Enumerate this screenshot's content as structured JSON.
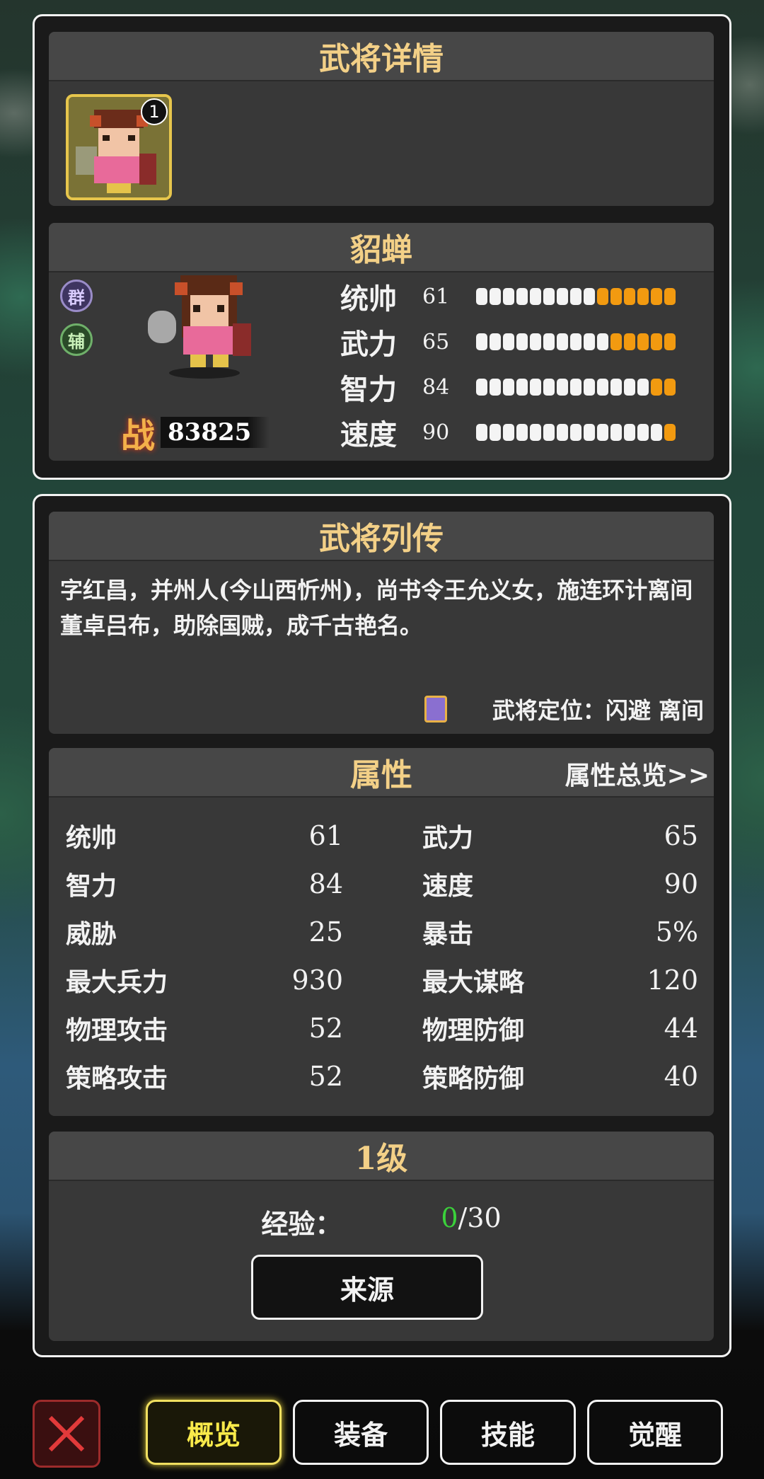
{
  "details": {
    "title": "武将详情",
    "portrait_level": "1"
  },
  "hero": {
    "name": "貂蝉",
    "faction_tags": [
      "群",
      "辅"
    ],
    "power_icon": "战",
    "power": "83825",
    "stats": [
      {
        "name": "统帅",
        "value": "61",
        "fill": 0.6
      },
      {
        "name": "武力",
        "value": "65",
        "fill": 0.65
      },
      {
        "name": "智力",
        "value": "84",
        "fill": 0.85
      },
      {
        "name": "速度",
        "value": "90",
        "fill": 0.9
      }
    ]
  },
  "biography": {
    "title": "武将列传",
    "text": "字红昌，并州人(今山西忻州)，尚书令王允义女，施连环计离间董卓吕布，助除国贼，成千古艳名。",
    "role_label": "武将定位：闪避 离间"
  },
  "attributes": {
    "title": "属性",
    "overview_link": "属性总览>>",
    "items": [
      {
        "name": "统帅",
        "value": "61"
      },
      {
        "name": "武力",
        "value": "65"
      },
      {
        "name": "智力",
        "value": "84"
      },
      {
        "name": "速度",
        "value": "90"
      },
      {
        "name": "威胁",
        "value": "25"
      },
      {
        "name": "暴击",
        "value": "5%"
      },
      {
        "name": "最大兵力",
        "value": "930"
      },
      {
        "name": "最大谋略",
        "value": "120"
      },
      {
        "name": "物理攻击",
        "value": "52"
      },
      {
        "name": "物理防御",
        "value": "44"
      },
      {
        "name": "策略攻击",
        "value": "52"
      },
      {
        "name": "策略防御",
        "value": "40"
      }
    ]
  },
  "level": {
    "title": "1级",
    "exp_label": "经验：",
    "exp_current": "0",
    "exp_total": "/30",
    "source_button": "来源"
  },
  "tabs": [
    {
      "label": "概览",
      "active": true
    },
    {
      "label": "装备",
      "active": false
    },
    {
      "label": "技能",
      "active": false
    },
    {
      "label": "觉醒",
      "active": false
    }
  ],
  "colors": {
    "accent_gold": "#f3d087",
    "bar_orange": "#f29a10",
    "exp_green": "#3bd13b",
    "active_tab": "#f9ea4a"
  }
}
